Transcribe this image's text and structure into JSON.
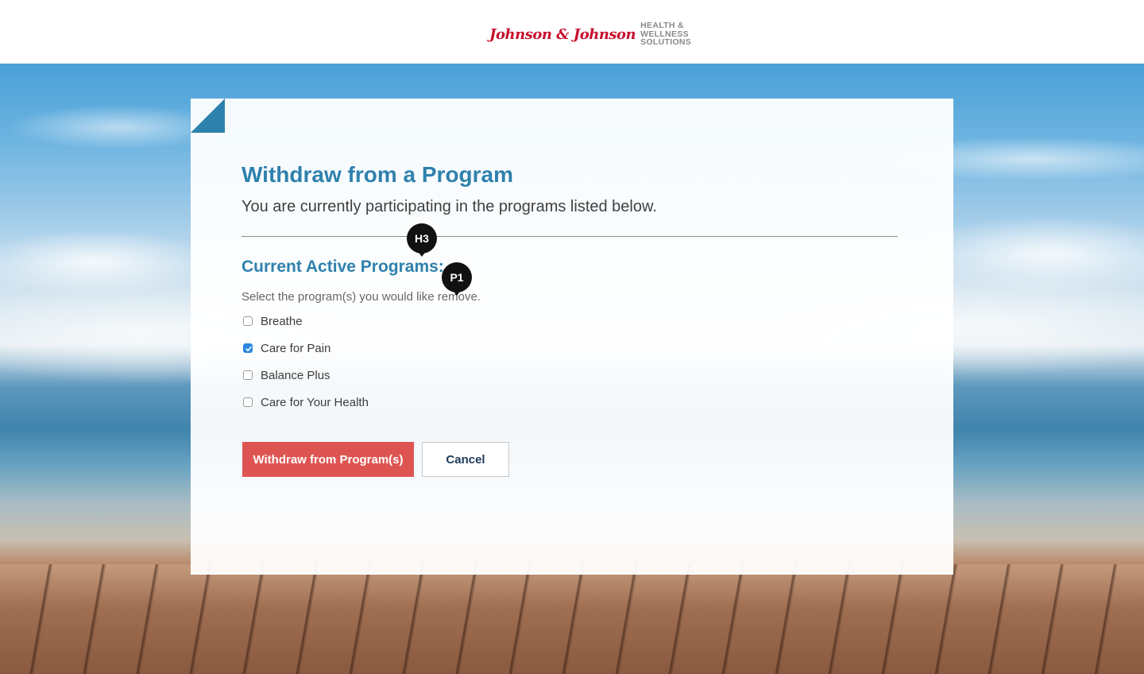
{
  "header": {
    "logo_script": "Johnson & Johnson",
    "logo_lines": [
      "HEALTH &",
      "WELLNESS",
      "SOLUTIONS"
    ]
  },
  "page": {
    "title": "Withdraw from a Program",
    "subtitle": "You are currently participating in the programs listed below."
  },
  "programs_section": {
    "title": "Current Active Programs:",
    "instructions": "Select the program(s) you would like remove.",
    "items": [
      {
        "label": "Breathe",
        "checked": false
      },
      {
        "label": "Care for Pain",
        "checked": true
      },
      {
        "label": "Balance Plus",
        "checked": false
      },
      {
        "label": "Care for Your Health",
        "checked": false
      }
    ]
  },
  "actions": {
    "withdraw_label": "Withdraw from Program(s)",
    "cancel_label": "Cancel"
  },
  "annotations": {
    "h3_label": "H3",
    "p1_label": "P1"
  },
  "colors": {
    "accent_blue": "#2f81ad",
    "danger_red": "#de5452",
    "checkbox_blue": "#2a86e0",
    "logo_red": "#c8102e"
  }
}
